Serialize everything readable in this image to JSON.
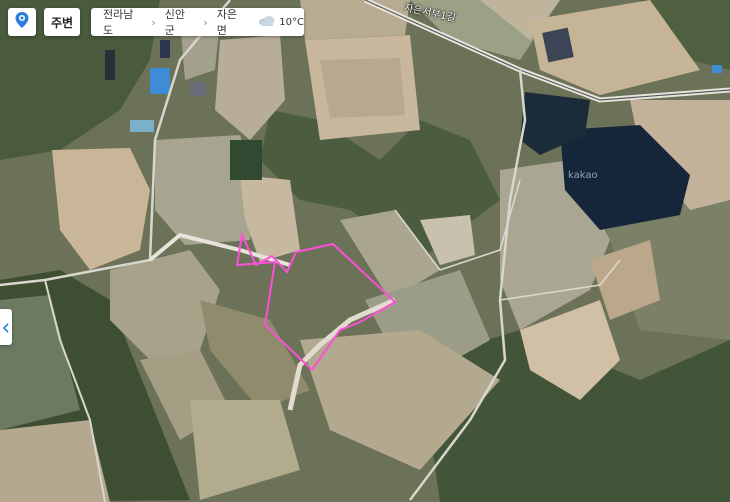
{
  "toolbar": {
    "location_icon": "map-pin-icon",
    "nearby_label": "주변"
  },
  "breadcrumb": {
    "items": [
      "전라남도",
      "신안군",
      "자은면"
    ],
    "weather_icon": "cloudy-icon",
    "temperature": "10°C"
  },
  "map": {
    "road_label": "자은서부1길",
    "watermark": "kakao",
    "parcel_outline_color": "#ff4fd8"
  }
}
